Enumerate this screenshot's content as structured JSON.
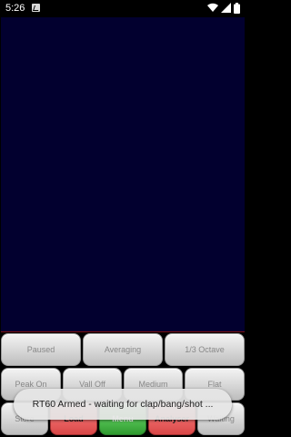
{
  "status_bar": {
    "time": "5:26",
    "icons": [
      "app-notification-icon",
      "wifi-icon",
      "signal-icon",
      "battery-icon"
    ]
  },
  "spectrum": {
    "background": "#02002f"
  },
  "row1": [
    {
      "label": "Paused"
    },
    {
      "label": "Averaging"
    },
    {
      "label": "1/3 Octave"
    }
  ],
  "row2": [
    {
      "label": "Peak On"
    },
    {
      "label": "Vall Off"
    },
    {
      "label": "Medium"
    },
    {
      "label": "Flat"
    }
  ],
  "row3": [
    {
      "label": "Store"
    },
    {
      "label": "Load"
    },
    {
      "label": "Menu"
    },
    {
      "label": "Analyser"
    },
    {
      "label": "Waiting"
    }
  ],
  "toast": {
    "message": "RT60 Armed - waiting for clap/bang/shot ..."
  },
  "colors": {
    "red_button": "#e05555",
    "green_button": "#4cb84c",
    "spectrum_bg": "#02002f"
  }
}
